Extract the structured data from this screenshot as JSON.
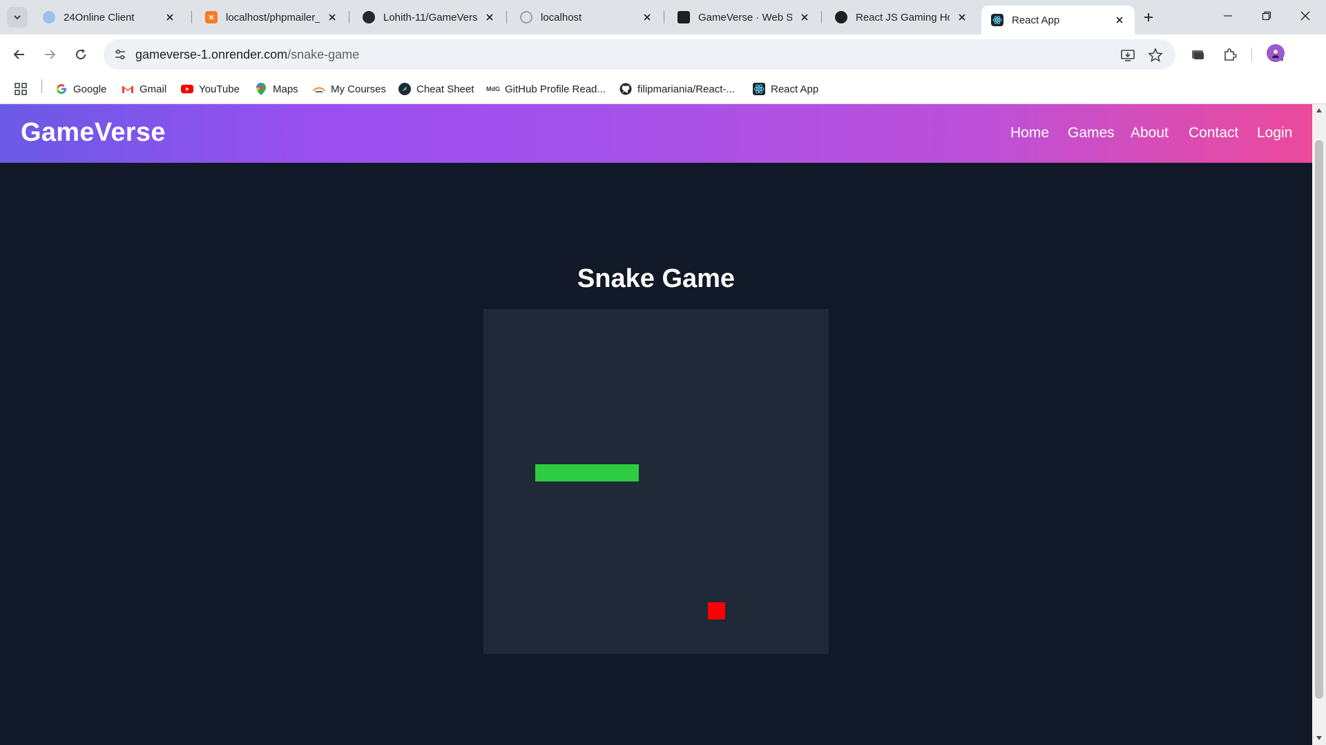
{
  "browser": {
    "tabs": [
      {
        "label": "24Online Client",
        "icon": "cloud-icon",
        "active": false
      },
      {
        "label": "localhost/phpmailer_",
        "icon": "xampp-icon",
        "active": false
      },
      {
        "label": "Lohith-11/GameVers",
        "icon": "github-icon",
        "active": false
      },
      {
        "label": "localhost",
        "icon": "globe-icon",
        "active": false
      },
      {
        "label": "GameVerse · Web S",
        "icon": "render-icon",
        "active": false
      },
      {
        "label": "React JS Gaming Ho",
        "icon": "chatgpt-icon",
        "active": false
      },
      {
        "label": "React App",
        "icon": "react-icon",
        "active": true
      }
    ],
    "url_host": "gameverse-1.onrender.com",
    "url_path": "/snake-game",
    "bookmarks": [
      {
        "label": "Google",
        "icon": "google-icon"
      },
      {
        "label": "Gmail",
        "icon": "gmail-icon"
      },
      {
        "label": "YouTube",
        "icon": "youtube-icon"
      },
      {
        "label": "Maps",
        "icon": "maps-icon"
      },
      {
        "label": "My Courses",
        "icon": "courses-icon"
      },
      {
        "label": "Cheat Sheet",
        "icon": "cheatsheet-icon"
      },
      {
        "label": "GitHub Profile Read...",
        "icon": "mdg-icon"
      },
      {
        "label": "filipmariania/React-...",
        "icon": "github-icon"
      },
      {
        "label": "React App",
        "icon": "react-icon"
      }
    ]
  },
  "site": {
    "brand": "GameVerse",
    "nav": [
      "Home",
      "Games",
      "About",
      "Contact",
      "Login"
    ],
    "colors": {
      "gradient_start": "#6a5ae6",
      "gradient_end": "#ec4a9a",
      "background": "#111827",
      "board": "#1f2937"
    }
  },
  "game": {
    "title": "Snake Game",
    "grid_size": 20,
    "snake_color": "#2ecc40",
    "food_color": "#ff0000",
    "snake": [
      [
        3,
        9
      ],
      [
        4,
        9
      ],
      [
        5,
        9
      ],
      [
        6,
        9
      ],
      [
        7,
        9
      ],
      [
        8,
        9
      ]
    ],
    "food": [
      13,
      17
    ]
  }
}
